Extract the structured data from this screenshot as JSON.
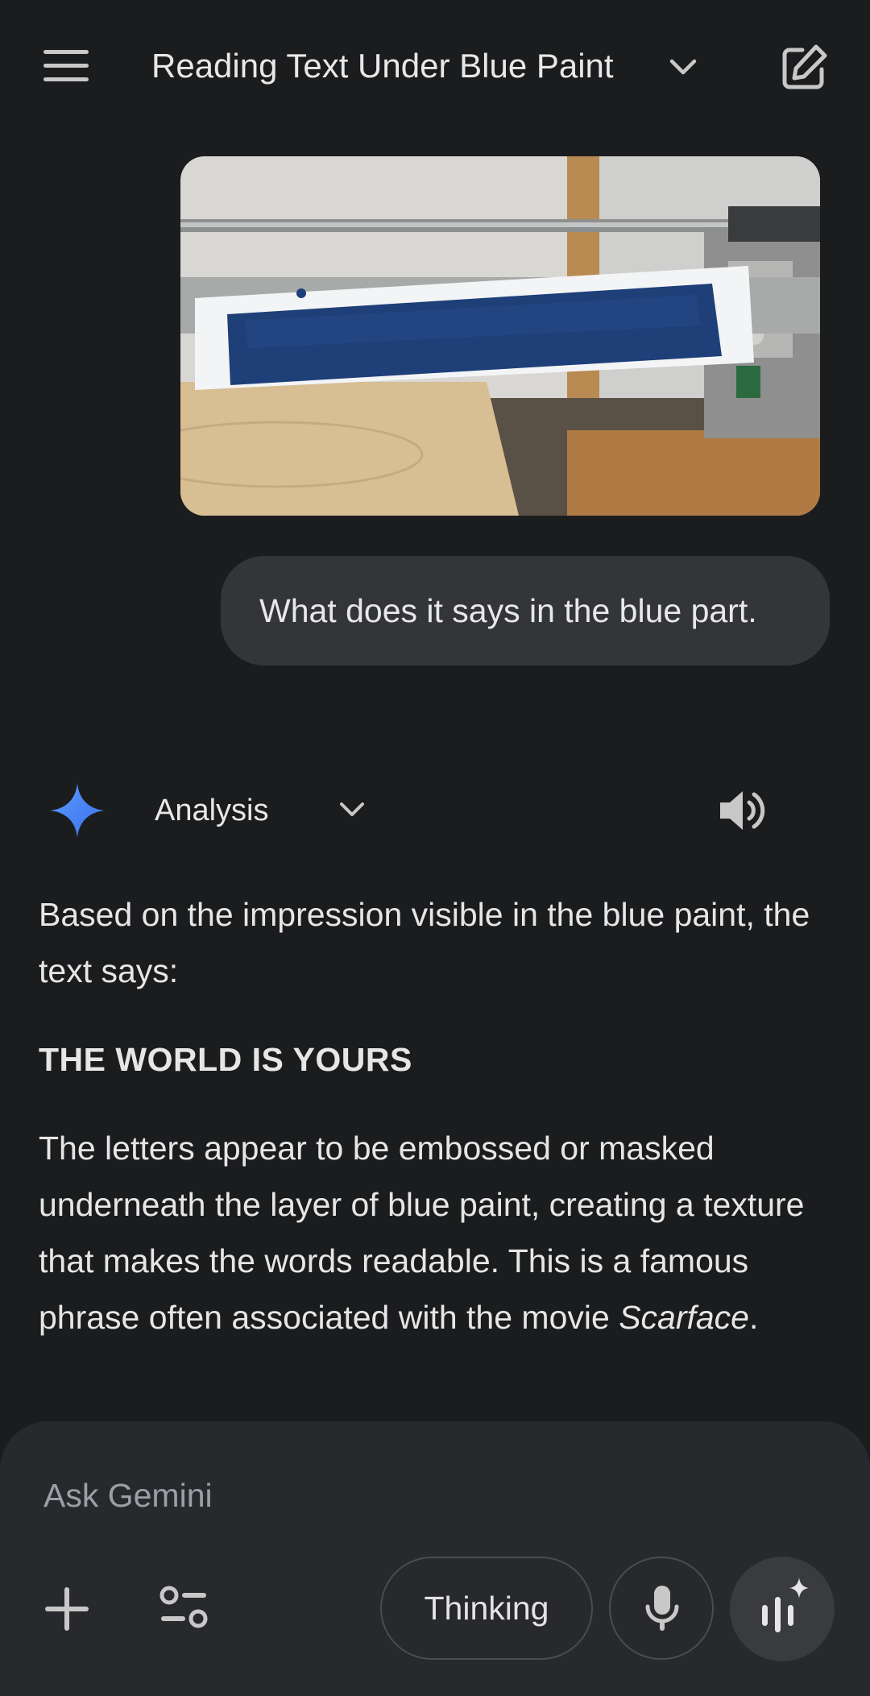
{
  "header": {
    "title": "Reading Text Under Blue Paint",
    "menu_icon": "menu-icon",
    "title_dropdown_icon": "chevron-down-icon",
    "new_chat_icon": "edit-icon"
  },
  "conversation": {
    "user_message": "What does it says in the blue part.",
    "model": {
      "mode_label": "Analysis",
      "paragraph1": "Based on the impression visible in the blue paint, the text says:",
      "highlight": "THE WORLD IS YOURS",
      "paragraph3_text": "The letters appear to be embossed or masked underneath the layer of blue paint, creating a texture that makes the words readable. This is a famous phrase often associated with the movie ",
      "paragraph3_italic": "Scarface",
      "paragraph3_end": "."
    }
  },
  "composer": {
    "placeholder": "Ask Gemini",
    "thinking_label": "Thinking"
  },
  "colors": {
    "background": "#1b1c1e",
    "bubble": "#333538",
    "composer": "#28292c",
    "gemini_blue": "#4c8df6",
    "paint_blue": "#1e3f78"
  }
}
